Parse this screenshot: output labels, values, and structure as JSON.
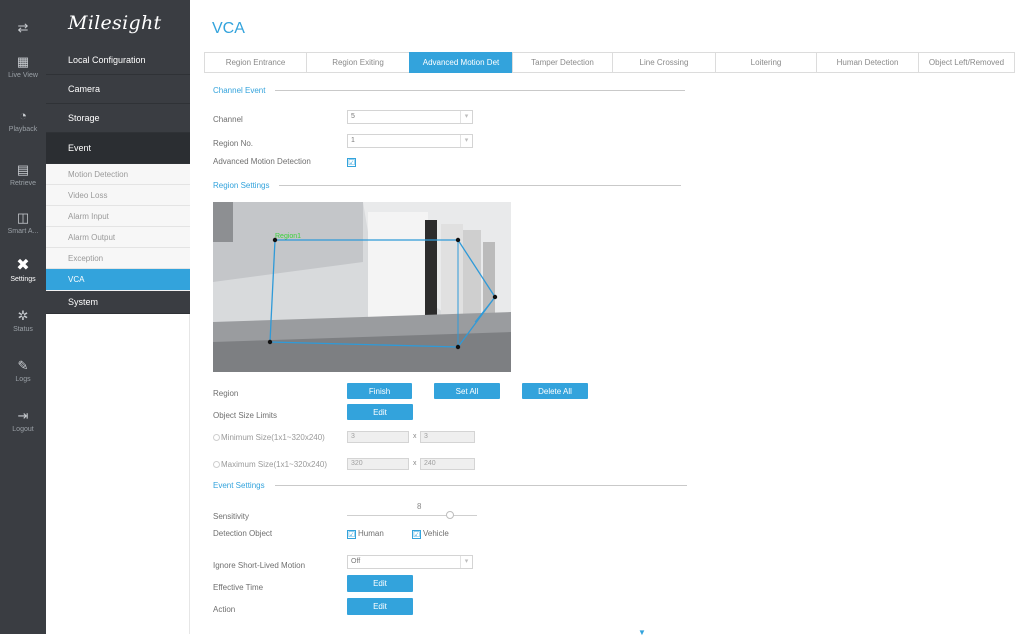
{
  "rail": {
    "items": [
      {
        "label": "",
        "icon": "menu-toggle-icon"
      },
      {
        "label": "Live View",
        "icon": "live-view-icon"
      },
      {
        "label": "Playback",
        "icon": "playback-icon"
      },
      {
        "label": "Retrieve",
        "icon": "retrieve-icon"
      },
      {
        "label": "Smart A...",
        "icon": "smart-analysis-icon"
      },
      {
        "label": "Settings",
        "icon": "settings-icon"
      },
      {
        "label": "Status",
        "icon": "status-icon"
      },
      {
        "label": "Logs",
        "icon": "logs-icon"
      },
      {
        "label": "Logout",
        "icon": "logout-icon"
      }
    ]
  },
  "menu": {
    "logo": "Milesight",
    "main": [
      "Local Configuration",
      "Camera",
      "Storage",
      "Event"
    ],
    "sub": [
      "Motion Detection",
      "Video Loss",
      "Alarm Input",
      "Alarm Output",
      "Exception",
      "VCA"
    ],
    "system": "System"
  },
  "page": {
    "title": "VCA",
    "tabs": [
      "Region Entrance",
      "Region Exiting",
      "Advanced Motion Det",
      "Tamper Detection",
      "Line Crossing",
      "Loitering",
      "Human Detection",
      "Object Left/Removed"
    ]
  },
  "channel_event": {
    "heading": "Channel Event",
    "channel_label": "Channel",
    "channel_value": "5",
    "region_label": "Region No.",
    "region_value": "1",
    "amd_label": "Advanced Motion Detection",
    "amd_checked": "☑"
  },
  "region_settings": {
    "heading": "Region Settings",
    "region_tag": "Region1",
    "region_label": "Region",
    "finish": "Finish",
    "set_all": "Set All",
    "delete_all": "Delete All",
    "size_label": "Object Size Limits",
    "edit": "Edit",
    "min_label": "Minimum Size(1x1~320x240)",
    "min_w": "3",
    "min_h": "3",
    "max_label": "Maximum Size(1x1~320x240)",
    "max_w": "320",
    "max_h": "240",
    "x": "x"
  },
  "event_settings": {
    "heading": "Event Settings",
    "sensitivity_label": "Sensitivity",
    "sensitivity_value": "8",
    "detection_label": "Detection Object",
    "human": "Human",
    "vehicle": "Vehicle",
    "ignore_label": "Ignore Short-Lived Motion",
    "ignore_value": "Off",
    "effective_label": "Effective Time",
    "effective_btn": "Edit",
    "action_label": "Action",
    "action_btn": "Edit"
  },
  "colors": {
    "accent": "#33a3dc",
    "rail": "#3a3d42",
    "region_line": "#2f9ad8",
    "region_text": "#3cd23c"
  }
}
